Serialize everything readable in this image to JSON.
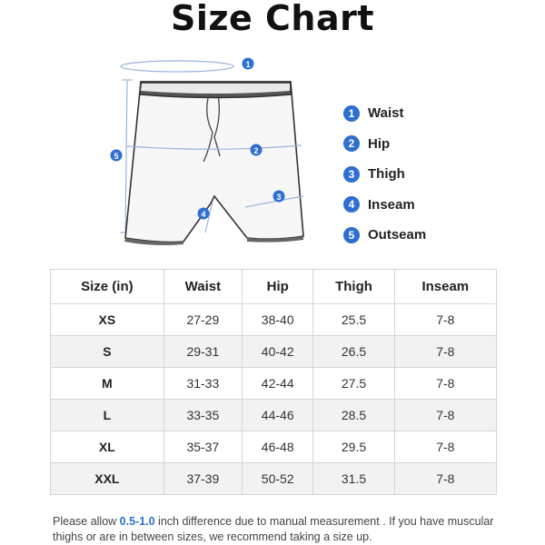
{
  "title": "Size Chart",
  "legend": [
    {
      "num": "1",
      "label": "Waist"
    },
    {
      "num": "2",
      "label": "Hip"
    },
    {
      "num": "3",
      "label": "Thigh"
    },
    {
      "num": "4",
      "label": "Inseam"
    },
    {
      "num": "5",
      "label": "Outseam"
    }
  ],
  "diagram_markers": [
    "1",
    "2",
    "3",
    "4",
    "5"
  ],
  "table": {
    "headers": [
      "Size (in)",
      "Waist",
      "Hip",
      "Thigh",
      "Inseam"
    ],
    "rows": [
      [
        "XS",
        "27-29",
        "38-40",
        "25.5",
        "7-8"
      ],
      [
        "S",
        "29-31",
        "40-42",
        "26.5",
        "7-8"
      ],
      [
        "M",
        "31-33",
        "42-44",
        "27.5",
        "7-8"
      ],
      [
        "L",
        "33-35",
        "44-46",
        "28.5",
        "7-8"
      ],
      [
        "XL",
        "35-37",
        "46-48",
        "29.5",
        "7-8"
      ],
      [
        "XXL",
        "37-39",
        "50-52",
        "31.5",
        "7-8"
      ]
    ]
  },
  "note": {
    "before": "Please allow ",
    "highlight": "0.5-1.0",
    "after": " inch difference due to manual measurement . If you have muscular thighs or are in between sizes, we recommend taking a size up."
  },
  "colors": {
    "accent": "#2f6fcf",
    "stripe": "#f2f2f2",
    "border": "#d5d5d5"
  }
}
